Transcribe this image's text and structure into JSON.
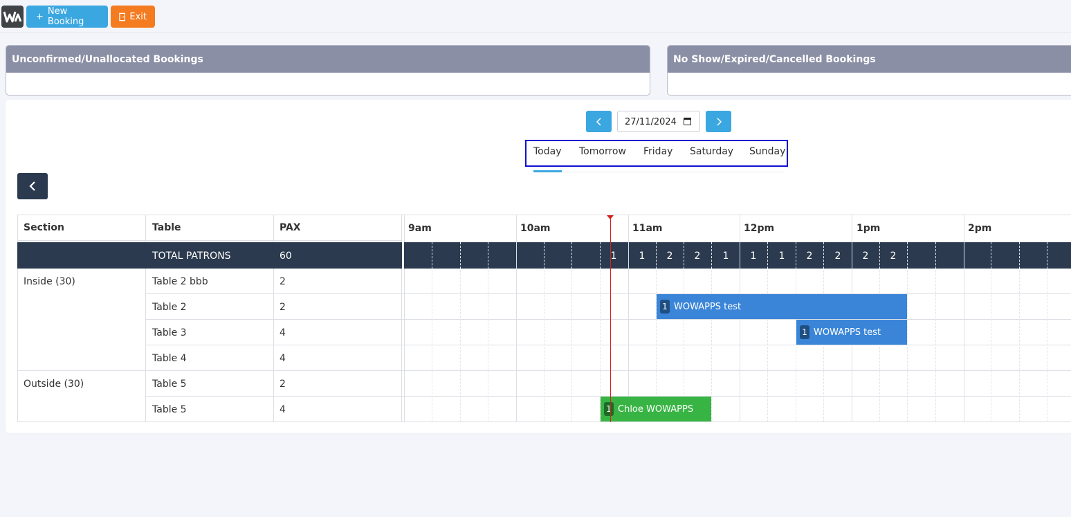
{
  "toolbar": {
    "logo": "W",
    "new_booking_label": "New Booking",
    "new_booking_icon": "+",
    "exit_label": "Exit"
  },
  "panels": {
    "unconfirmed_title": "Unconfirmed/Unallocated Bookings",
    "cancelled_title": "No Show/Expired/Cancelled Bookings"
  },
  "date_nav": {
    "date_value": "27/11/2024",
    "tabs": [
      "Today",
      "Tomorrow",
      "Friday",
      "Saturday",
      "Sunday"
    ],
    "active_tab": "Today"
  },
  "table": {
    "headers": {
      "section": "Section",
      "table": "Table",
      "pax": "PAX"
    },
    "total_label": "TOTAL PATRONS",
    "total_value": "60",
    "rows": [
      {
        "section": "Inside (30)",
        "table": "Table 2 bbb",
        "pax": "2"
      },
      {
        "section": "",
        "table": "Table 2",
        "pax": "2"
      },
      {
        "section": "",
        "table": "Table 3",
        "pax": "4"
      },
      {
        "section": "",
        "table": "Table 4",
        "pax": "4"
      },
      {
        "section": "Outside (30)",
        "table": "Table 5",
        "pax": "2"
      },
      {
        "section": "",
        "table": "Table 5",
        "pax": "4"
      }
    ]
  },
  "timeline": {
    "hours": [
      "9am",
      "10am",
      "11am",
      "12pm",
      "1pm",
      "2pm"
    ],
    "slot_counts": [
      "1",
      "1",
      "2",
      "2",
      "1",
      "1",
      "1",
      "2",
      "2",
      "2",
      "2"
    ],
    "bookings": [
      {
        "row": 1,
        "pax": "1",
        "name": "WOWAPPS test",
        "color": "#3a85d8"
      },
      {
        "row": 2,
        "pax": "1",
        "name": "WOWAPPS test",
        "color": "#3a85d8"
      },
      {
        "row": 5,
        "pax": "1",
        "name": "Chloe WOWAPPS",
        "color": "#38b444"
      }
    ]
  },
  "colors": {
    "accent": "#3ba7e0",
    "exit": "#f47b20",
    "dark_row": "#2b3a4e",
    "panel_header": "#8b8fa5",
    "now_line": "#d62020"
  }
}
